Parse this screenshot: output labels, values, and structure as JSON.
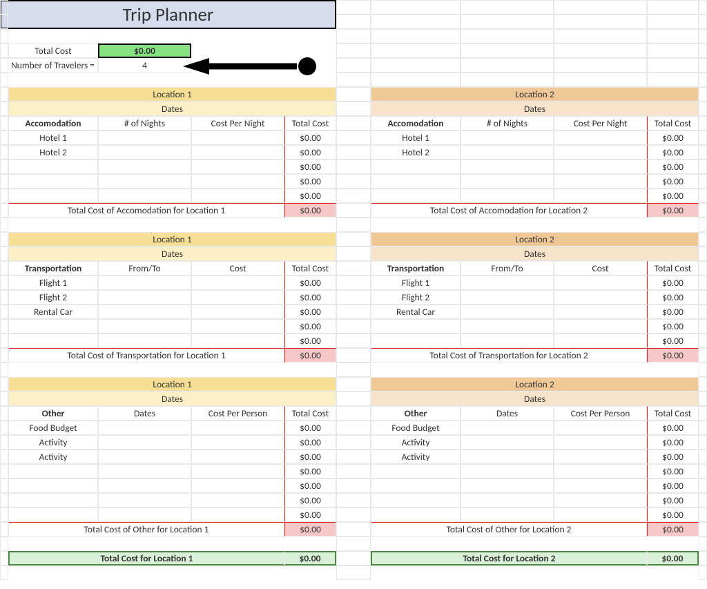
{
  "title": "Trip Planner",
  "summary": {
    "total_cost_label": "Total Cost",
    "total_cost_value": "$0.00",
    "num_travelers_label": "Number of Travelers  =",
    "num_travelers_value": "4"
  },
  "zero": "$0.00",
  "loc1": {
    "name": "Location 1",
    "dates": "Dates",
    "accom": {
      "h_accom": "Accomodation",
      "h_nights": "# of Nights",
      "h_cpn": "Cost Per Night",
      "h_total": "Total Cost",
      "rows": [
        "Hotel 1",
        "Hotel 2"
      ],
      "sum_label": "Total Cost of Accomodation for Location 1",
      "sum_val": "$0.00"
    },
    "trans": {
      "h_trans": "Transportation",
      "h_fromto": "From/To",
      "h_cost": "Cost",
      "h_total": "Total Cost",
      "rows": [
        "Flight 1",
        "Flight 2",
        "Rental Car"
      ],
      "sum_label": "Total Cost of Transportation for Location 1",
      "sum_val": "$0.00"
    },
    "other": {
      "h_other": "Other",
      "h_dates": "Dates",
      "h_cpp": "Cost Per Person",
      "h_total": "Total Cost",
      "rows": [
        "Food Budget",
        "Activity",
        "Activity"
      ],
      "sum_label": "Total Cost of Other for Location 1",
      "sum_val": "$0.00"
    },
    "grand_label": "Total Cost for Location 1",
    "grand_val": "$0.00"
  },
  "loc2": {
    "name": "Location 2",
    "dates": "Dates",
    "accom": {
      "h_accom": "Accomodation",
      "h_nights": "# of Nights",
      "h_cpn": "Cost Per Night",
      "h_total": "Total Cost",
      "rows": [
        "Hotel 1",
        "Hotel 2"
      ],
      "sum_label": "Total Cost of Accomodation for Location 2",
      "sum_val": "$0.00"
    },
    "trans": {
      "h_trans": "Transportation",
      "h_fromto": "From/To",
      "h_cost": "Cost",
      "h_total": "Total Cost",
      "rows": [
        "Flight 1",
        "Flight 2",
        "Rental Car"
      ],
      "sum_label": "Total Cost of Transportation for Location 2",
      "sum_val": "$0.00"
    },
    "other": {
      "h_other": "Other",
      "h_dates": "Dates",
      "h_cpp": "Cost Per Person",
      "h_total": "Total Cost",
      "rows": [
        "Food Budget",
        "Activity",
        "Activity"
      ],
      "sum_label": "Total Cost of Other for Location 2",
      "sum_val": "$0.00"
    },
    "grand_label": "Total Cost for Location 2",
    "grand_val": "$0.00"
  }
}
